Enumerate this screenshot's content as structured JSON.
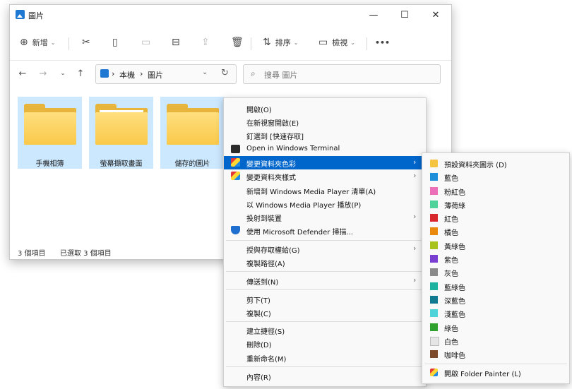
{
  "window": {
    "title": "圖片",
    "controls": {
      "minimize": "—",
      "maximize": "☐",
      "close": "✕"
    }
  },
  "toolbar": {
    "new_label": "新增",
    "sort_label": "排序",
    "view_label": "檢視",
    "more": "•••"
  },
  "address": {
    "crumbs": [
      "本機",
      "圖片"
    ],
    "separator": "›"
  },
  "search": {
    "placeholder": "搜尋 圖片"
  },
  "folders": [
    {
      "name": "手機相簿"
    },
    {
      "name": "螢幕擷取畫面"
    },
    {
      "name": "儲存的圖片"
    }
  ],
  "status": {
    "item_count": "3 個項目",
    "selected": "已選取 3 個項目"
  },
  "context_menu": {
    "items": [
      {
        "label": "開啟(O)",
        "icon": ""
      },
      {
        "label": "在新視窗開啟(E)",
        "icon": ""
      },
      {
        "label": "釘選到 [快速存取]",
        "icon": ""
      },
      {
        "label": "Open in Windows Terminal",
        "icon": "terminal-icon"
      },
      {
        "label": "變更資料夾色彩",
        "icon": "folder-painter-icon",
        "submenu": true,
        "highlighted": true
      },
      {
        "label": "變更資料夾樣式",
        "icon": "folder-painter-icon",
        "submenu": true
      },
      {
        "label": "新增到 Windows Media Player 清單(A)",
        "icon": ""
      },
      {
        "label": "以 Windows Media Player 播放(P)",
        "icon": ""
      },
      {
        "label": "投射到裝置",
        "icon": "",
        "submenu": true
      },
      {
        "label": "使用 Microsoft Defender 掃描...",
        "icon": "defender-shield-icon"
      },
      {
        "label": "授與存取權給(G)",
        "icon": "",
        "submenu": true
      },
      {
        "label": "複製路徑(A)",
        "icon": ""
      },
      {
        "label": "傳送到(N)",
        "icon": "",
        "submenu": true
      },
      {
        "label": "剪下(T)",
        "icon": ""
      },
      {
        "label": "複製(C)",
        "icon": ""
      },
      {
        "label": "建立捷徑(S)",
        "icon": ""
      },
      {
        "label": "刪除(D)",
        "icon": ""
      },
      {
        "label": "重新命名(M)",
        "icon": ""
      },
      {
        "label": "內容(R)",
        "icon": ""
      }
    ]
  },
  "color_submenu": {
    "items": [
      {
        "label": "預設資料夾圖示 (D)",
        "color": "#f5c542"
      },
      {
        "label": "藍色",
        "color": "#1e8fd8"
      },
      {
        "label": "粉紅色",
        "color": "#ec6fba"
      },
      {
        "label": "薄荷綠",
        "color": "#4fd39a"
      },
      {
        "label": "紅色",
        "color": "#d9272e"
      },
      {
        "label": "橘色",
        "color": "#e8890c"
      },
      {
        "label": "黃綠色",
        "color": "#a7c21a"
      },
      {
        "label": "紫色",
        "color": "#7a3fd1"
      },
      {
        "label": "灰色",
        "color": "#8a8a8a"
      },
      {
        "label": "藍綠色",
        "color": "#20b2a0"
      },
      {
        "label": "深藍色",
        "color": "#127a90"
      },
      {
        "label": "淺藍色",
        "color": "#4fd3d9"
      },
      {
        "label": "綠色",
        "color": "#2ea12e"
      },
      {
        "label": "白色",
        "color": "#e6e6e6"
      },
      {
        "label": "咖啡色",
        "color": "#7a4a2a"
      },
      {
        "label": "開啟 Folder Painter (L)",
        "color": ""
      }
    ]
  }
}
